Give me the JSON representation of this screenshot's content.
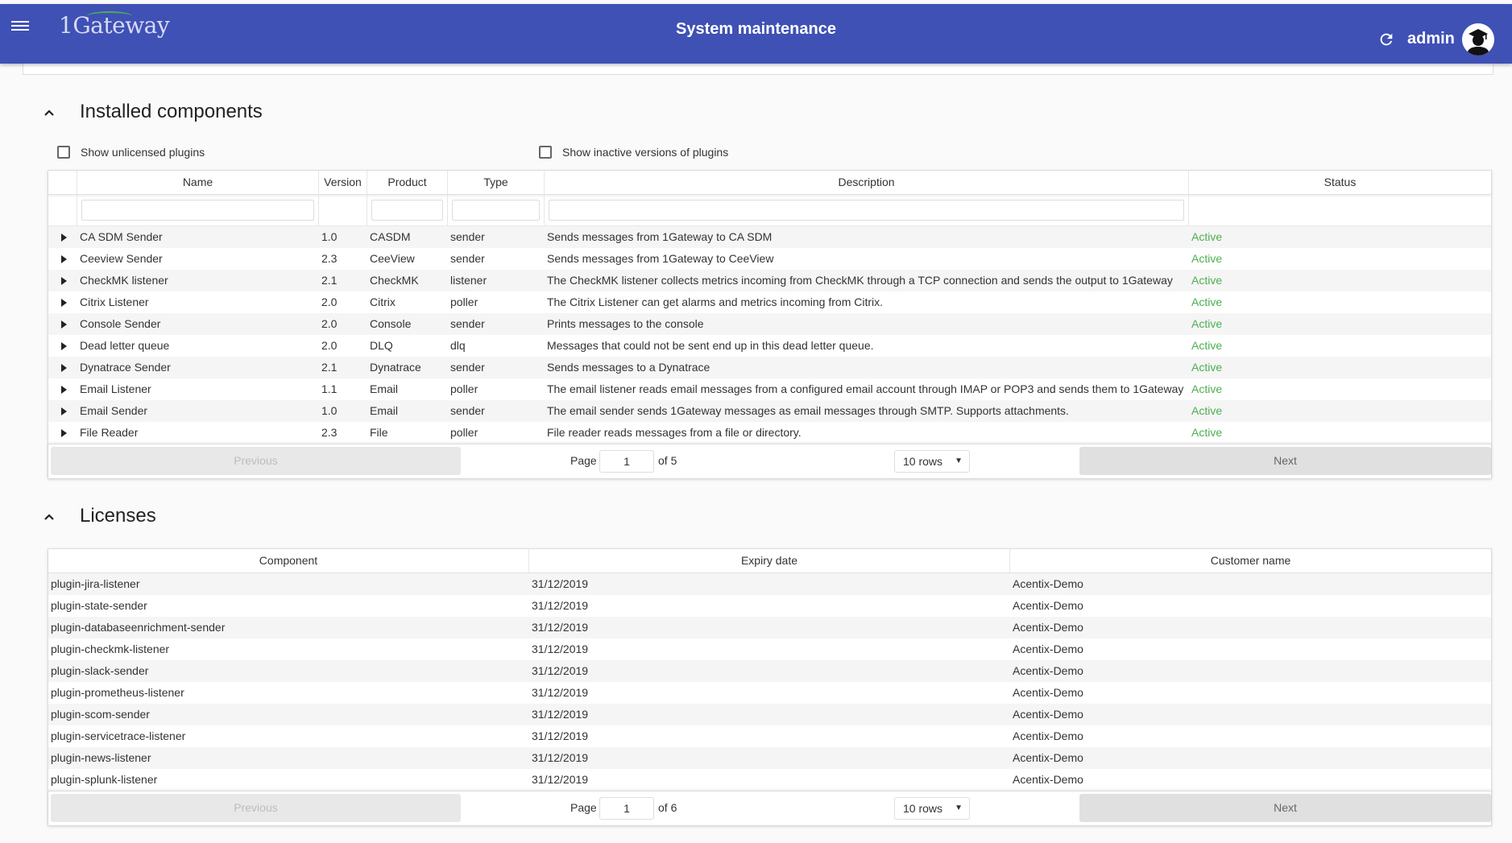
{
  "header": {
    "logo": "1Gateway",
    "title": "System maintenance",
    "user": "admin"
  },
  "components": {
    "title": "Installed components",
    "show_unlicensed": "Show unlicensed plugins",
    "show_inactive": "Show inactive versions of plugins",
    "columns": [
      "Name",
      "Version",
      "Product",
      "Type",
      "Description",
      "Status"
    ],
    "rows": [
      {
        "name": "CA SDM Sender",
        "version": "1.0",
        "product": "CASDM",
        "type": "sender",
        "description": "Sends messages from 1Gateway to CA SDM",
        "status": "Active"
      },
      {
        "name": "Ceeview Sender",
        "version": "2.3",
        "product": "CeeView",
        "type": "sender",
        "description": "Sends messages from 1Gateway to CeeView",
        "status": "Active"
      },
      {
        "name": "CheckMK listener",
        "version": "2.1",
        "product": "CheckMK",
        "type": "listener",
        "description": "The CheckMK listener collects metrics incoming from CheckMK through a TCP connection and sends the output to 1Gateway",
        "status": "Active"
      },
      {
        "name": "Citrix Listener",
        "version": "2.0",
        "product": "Citrix",
        "type": "poller",
        "description": "The Citrix Listener can get alarms and metrics incoming from Citrix.",
        "status": "Active"
      },
      {
        "name": "Console Sender",
        "version": "2.0",
        "product": "Console",
        "type": "sender",
        "description": "Prints messages to the console",
        "status": "Active"
      },
      {
        "name": "Dead letter queue",
        "version": "2.0",
        "product": "DLQ",
        "type": "dlq",
        "description": "Messages that could not be sent end up in this dead letter queue.",
        "status": "Active"
      },
      {
        "name": "Dynatrace Sender",
        "version": "2.1",
        "product": "Dynatrace",
        "type": "sender",
        "description": "Sends messages to a Dynatrace",
        "status": "Active"
      },
      {
        "name": "Email Listener",
        "version": "1.1",
        "product": "Email",
        "type": "poller",
        "description": "The email listener reads email messages from a configured email account through IMAP or POP3 and sends them to 1Gateway",
        "status": "Active"
      },
      {
        "name": "Email Sender",
        "version": "1.0",
        "product": "Email",
        "type": "sender",
        "description": "The email sender sends 1Gateway messages as email messages through SMTP. Supports attachments.",
        "status": "Active"
      },
      {
        "name": "File Reader",
        "version": "2.3",
        "product": "File",
        "type": "poller",
        "description": "File reader reads messages from a file or directory.",
        "status": "Active"
      }
    ],
    "pagination": {
      "previous": "Previous",
      "next": "Next",
      "page_label": "Page",
      "page": "1",
      "of": "of 5",
      "rows": "10 rows"
    }
  },
  "licenses": {
    "title": "Licenses",
    "columns": [
      "Component",
      "Expiry date",
      "Customer name"
    ],
    "rows": [
      {
        "component": "plugin-jira-listener",
        "expiry": "31/12/2019",
        "customer": "Acentix-Demo"
      },
      {
        "component": "plugin-state-sender",
        "expiry": "31/12/2019",
        "customer": "Acentix-Demo"
      },
      {
        "component": "plugin-databaseenrichment-sender",
        "expiry": "31/12/2019",
        "customer": "Acentix-Demo"
      },
      {
        "component": "plugin-checkmk-listener",
        "expiry": "31/12/2019",
        "customer": "Acentix-Demo"
      },
      {
        "component": "plugin-slack-sender",
        "expiry": "31/12/2019",
        "customer": "Acentix-Demo"
      },
      {
        "component": "plugin-prometheus-listener",
        "expiry": "31/12/2019",
        "customer": "Acentix-Demo"
      },
      {
        "component": "plugin-scom-sender",
        "expiry": "31/12/2019",
        "customer": "Acentix-Demo"
      },
      {
        "component": "plugin-servicetrace-listener",
        "expiry": "31/12/2019",
        "customer": "Acentix-Demo"
      },
      {
        "component": "plugin-news-listener",
        "expiry": "31/12/2019",
        "customer": "Acentix-Demo"
      },
      {
        "component": "plugin-splunk-listener",
        "expiry": "31/12/2019",
        "customer": "Acentix-Demo"
      }
    ],
    "pagination": {
      "previous": "Previous",
      "next": "Next",
      "page_label": "Page",
      "page": "1",
      "of": "of 6",
      "rows": "10 rows"
    }
  }
}
